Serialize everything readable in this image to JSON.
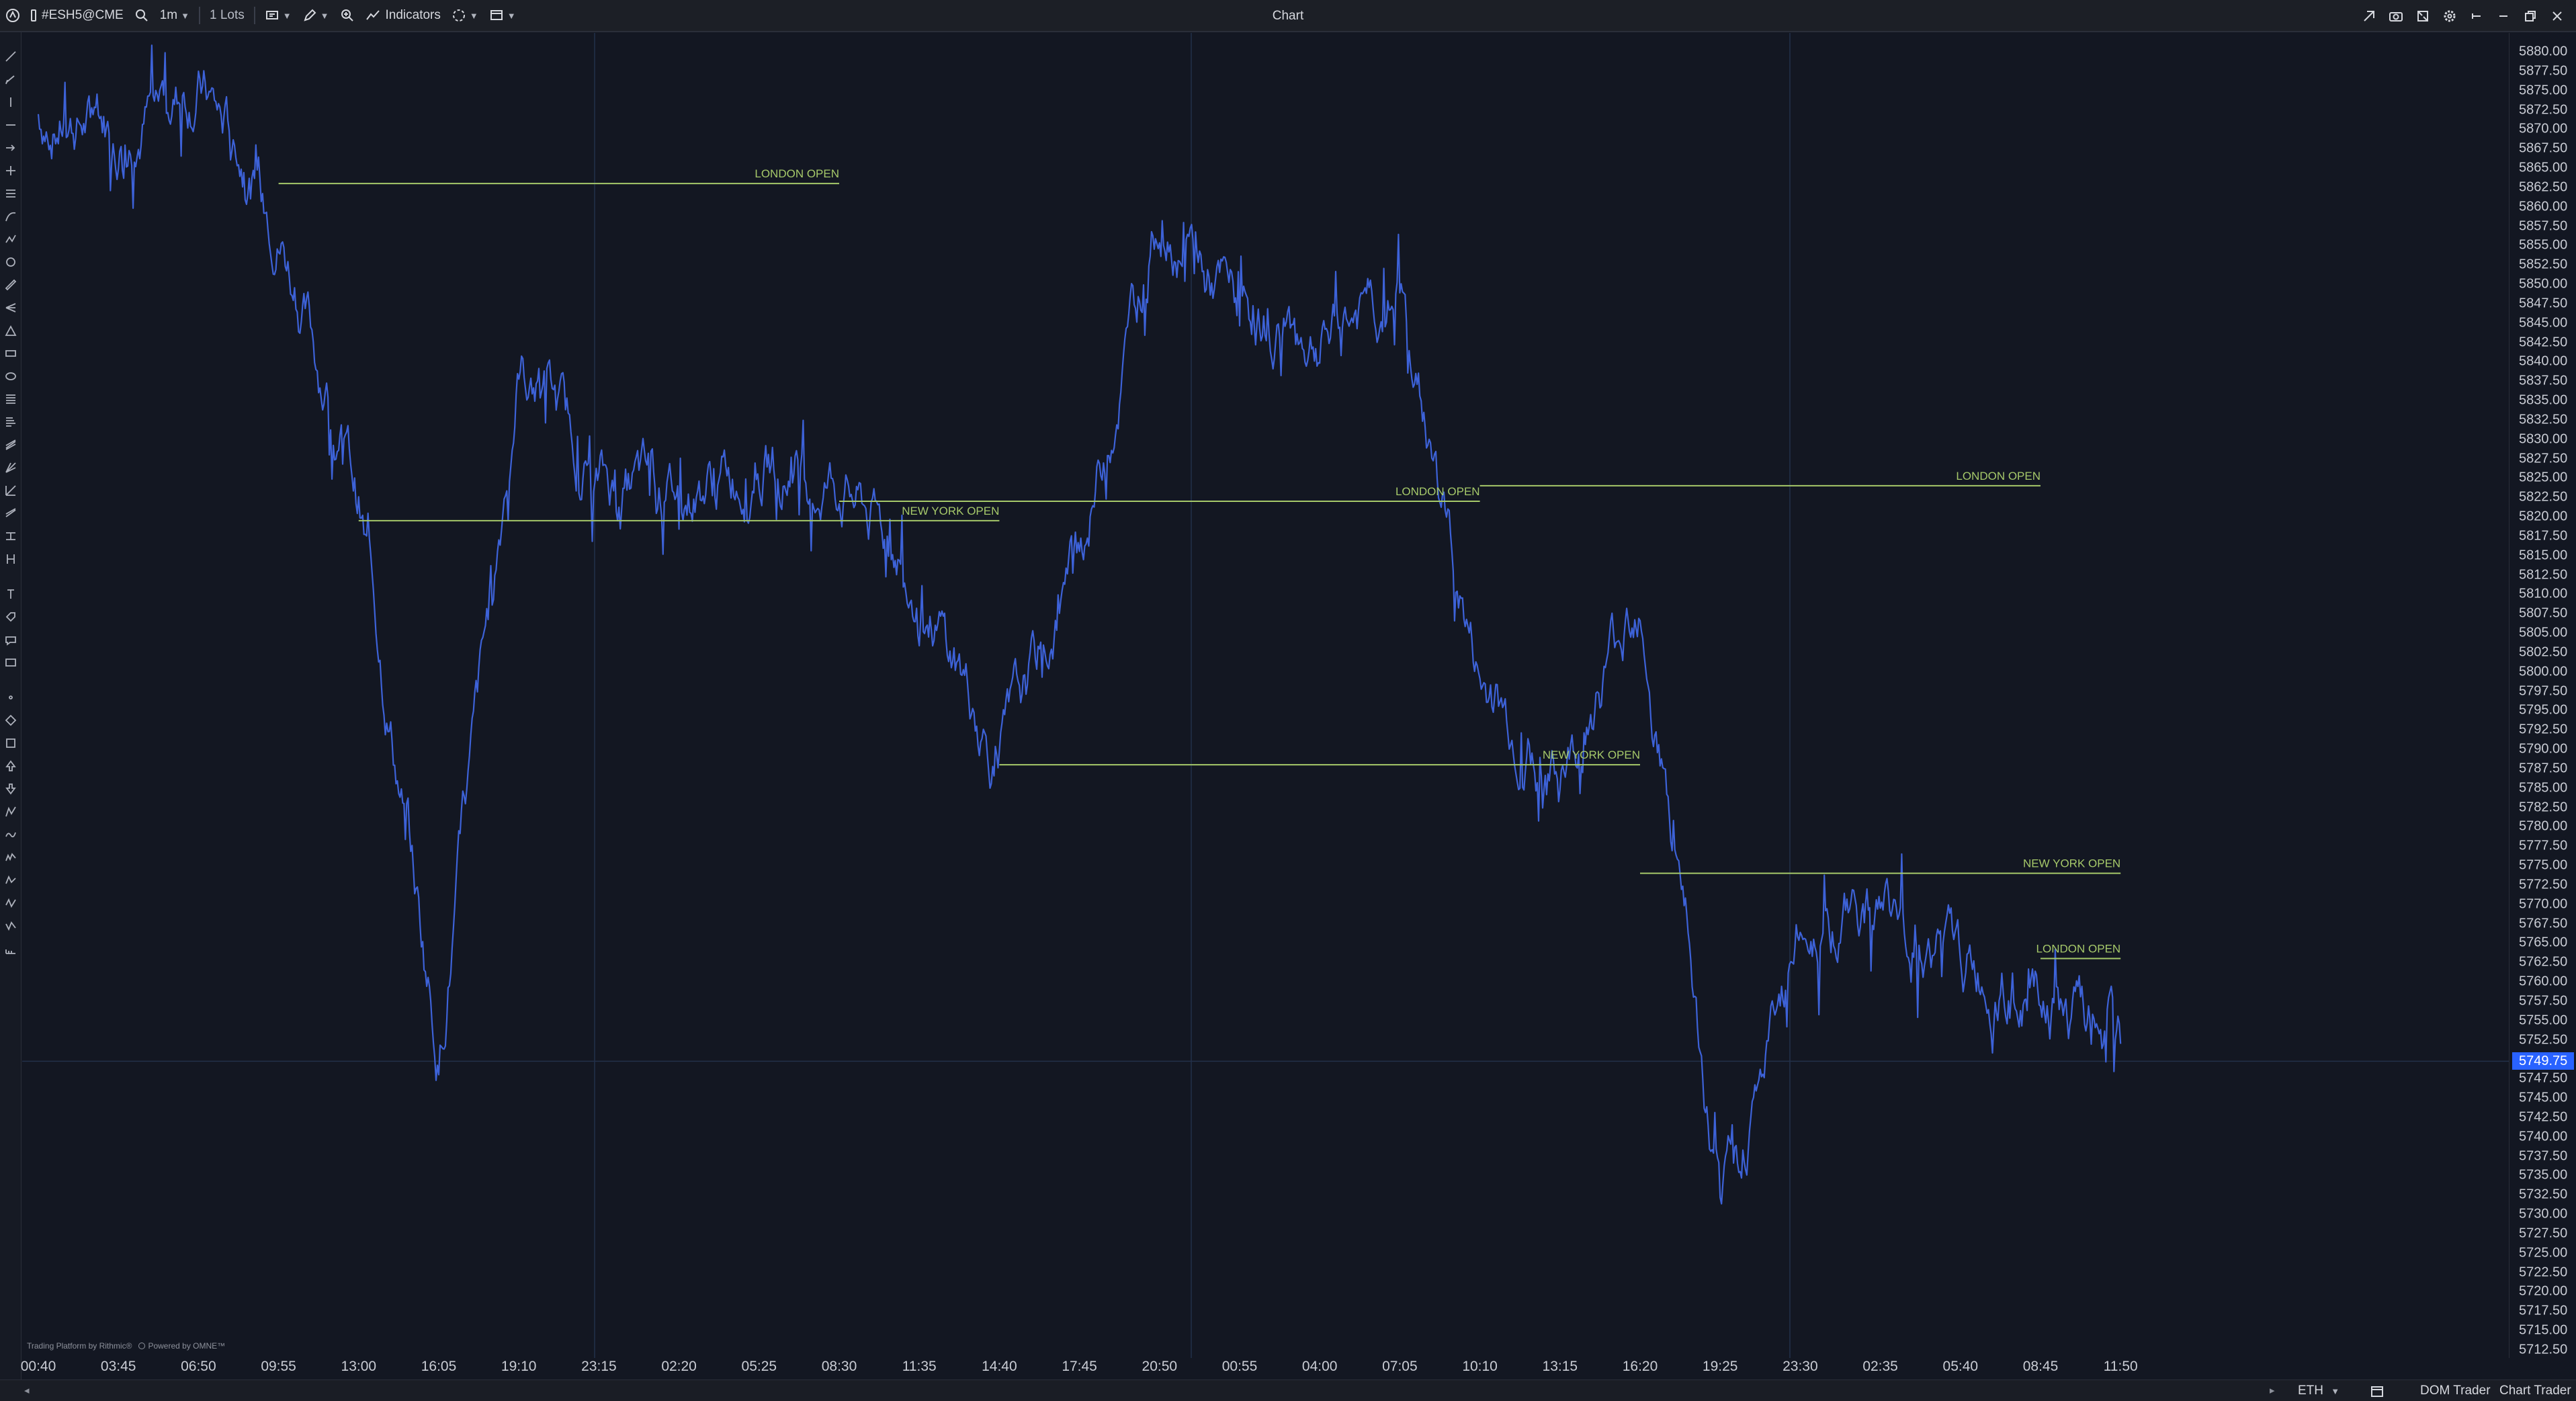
{
  "toolbar": {
    "symbol": "#ESH5@CME",
    "interval": "1m",
    "lots": "1 Lots",
    "indicators_label": "Indicators",
    "window_title": "Chart"
  },
  "price_scale": {
    "ticks": [
      "5880.00",
      "5877.50",
      "5875.00",
      "5872.50",
      "5870.00",
      "5867.50",
      "5865.00",
      "5862.50",
      "5860.00",
      "5857.50",
      "5855.00",
      "5852.50",
      "5850.00",
      "5847.50",
      "5845.00",
      "5842.50",
      "5840.00",
      "5837.50",
      "5835.00",
      "5832.50",
      "5830.00",
      "5827.50",
      "5825.00",
      "5822.50",
      "5820.00",
      "5817.50",
      "5815.00",
      "5812.50",
      "5810.00",
      "5807.50",
      "5805.00",
      "5802.50",
      "5800.00",
      "5797.50",
      "5795.00",
      "5792.50",
      "5790.00",
      "5787.50",
      "5785.00",
      "5782.50",
      "5780.00",
      "5777.50",
      "5775.00",
      "5772.50",
      "5770.00",
      "5767.50",
      "5765.00",
      "5762.50",
      "5760.00",
      "5757.50",
      "5755.00",
      "5752.50",
      "5750.00",
      "5747.50",
      "5745.00",
      "5742.50",
      "5740.00",
      "5737.50",
      "5735.00",
      "5732.50",
      "5730.00",
      "5727.50",
      "5725.00",
      "5722.50",
      "5720.00",
      "5717.50",
      "5715.00",
      "5712.50"
    ],
    "current_price": "5749.75"
  },
  "time_axis": {
    "ticks": [
      "00:40",
      "03:45",
      "06:50",
      "09:55",
      "13:00",
      "16:05",
      "19:10",
      "23:15",
      "02:20",
      "05:25",
      "08:30",
      "11:35",
      "14:40",
      "17:45",
      "20:50",
      "00:55",
      "04:00",
      "07:05",
      "10:10",
      "13:15",
      "16:20",
      "19:25",
      "23:30",
      "02:35",
      "05:40",
      "08:45",
      "11:50"
    ]
  },
  "chart_data": {
    "type": "line",
    "series": [
      {
        "values": [
          {
            "x": "00:40",
            "y": 5872
          },
          {
            "x": "03:45",
            "y": 5870
          },
          {
            "x": "06:50",
            "y": 5876
          },
          {
            "x": "09:55",
            "y": 5858
          },
          {
            "x": "13:00",
            "y": 5822
          },
          {
            "x": "16:05",
            "y": 5751
          },
          {
            "x": "19:10",
            "y": 5840
          },
          {
            "x": "23:15",
            "y": 5825
          },
          {
            "x": "02:20",
            "y": 5823
          },
          {
            "x": "05:25",
            "y": 5827
          },
          {
            "x": "08:30",
            "y": 5825
          },
          {
            "x": "11:35",
            "y": 5812
          },
          {
            "x": "14:40",
            "y": 5788
          },
          {
            "x": "17:45",
            "y": 5815
          },
          {
            "x": "20:50",
            "y": 5860
          },
          {
            "x": "00:55",
            "y": 5846
          },
          {
            "x": "04:00",
            "y": 5843
          },
          {
            "x": "07:05",
            "y": 5848
          },
          {
            "x": "10:10",
            "y": 5798
          },
          {
            "x": "13:15",
            "y": 5785
          },
          {
            "x": "16:20",
            "y": 5812
          },
          {
            "x": "19:25",
            "y": 5728
          },
          {
            "x": "23:30",
            "y": 5766
          },
          {
            "x": "02:35",
            "y": 5770
          },
          {
            "x": "05:40",
            "y": 5762
          },
          {
            "x": "08:45",
            "y": 5756
          },
          {
            "x": "11:50",
            "y": 5752
          }
        ]
      }
    ],
    "y_range": [
      5712.5,
      5880
    ],
    "grid": false,
    "line_color": "#3d62d8",
    "annotations": [
      {
        "label": "LONDON OPEN",
        "price": 5863,
        "from": "09:55",
        "to": "08:30"
      },
      {
        "label": "NEW YORK OPEN",
        "price": 5819.5,
        "from": "13:00",
        "to": "14:40"
      },
      {
        "label": "LONDON OPEN",
        "price": 5822,
        "from": "08:30",
        "to": "10:10"
      },
      {
        "label": "NEW YORK OPEN",
        "price": 5788,
        "from": "14:40",
        "to": "16:20"
      },
      {
        "label": "LONDON OPEN",
        "price": 5824,
        "from": "10:10",
        "to": "08:45"
      },
      {
        "label": "NEW YORK OPEN",
        "price": 5774,
        "from": "16:20",
        "to": "11:50"
      },
      {
        "label": "LONDON OPEN",
        "price": 5763,
        "from": "08:45",
        "to": "11:50"
      }
    ],
    "annotation_color": "#a6c96a"
  },
  "attribution": {
    "rithmic": "Trading Platform by Rithmic®",
    "omne": "Powered by OMNE™"
  },
  "bottombar": {
    "session": "ETH",
    "dom_trader": "DOM Trader",
    "chart_trader": "Chart Trader"
  },
  "icons": [
    "app-logo-icon",
    "search-icon",
    "chart-type-icon",
    "pencil-icon",
    "zoom-icon",
    "indicators-icon",
    "templates-icon",
    "layout-icon",
    "camera-icon",
    "settings-icon",
    "minimize-icon",
    "restore-icon",
    "close-icon",
    "calendar-icon"
  ]
}
